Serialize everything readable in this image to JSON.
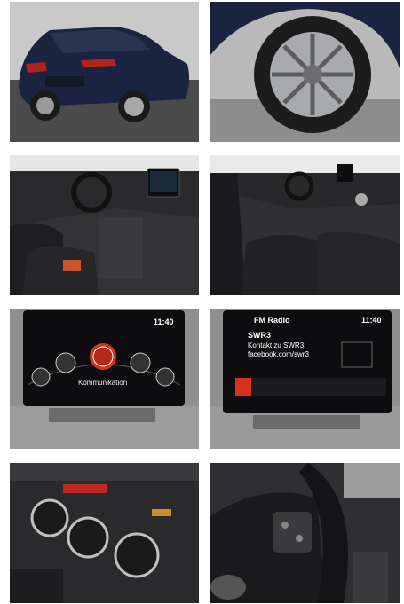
{
  "screen_left": {
    "clock": "11:40",
    "menu_label": "Kommunikation"
  },
  "screen_right": {
    "title": "FM Radio",
    "clock": "11:40",
    "station": "SWR3",
    "line1": "Kontakt zu SWR3:",
    "line2": "facebook.com/swr3"
  },
  "colors": {
    "car_paint": "#1a2340",
    "accent_red": "#d8321e",
    "screen_bg": "#0d0d10",
    "interior": "#2a2a2c"
  }
}
